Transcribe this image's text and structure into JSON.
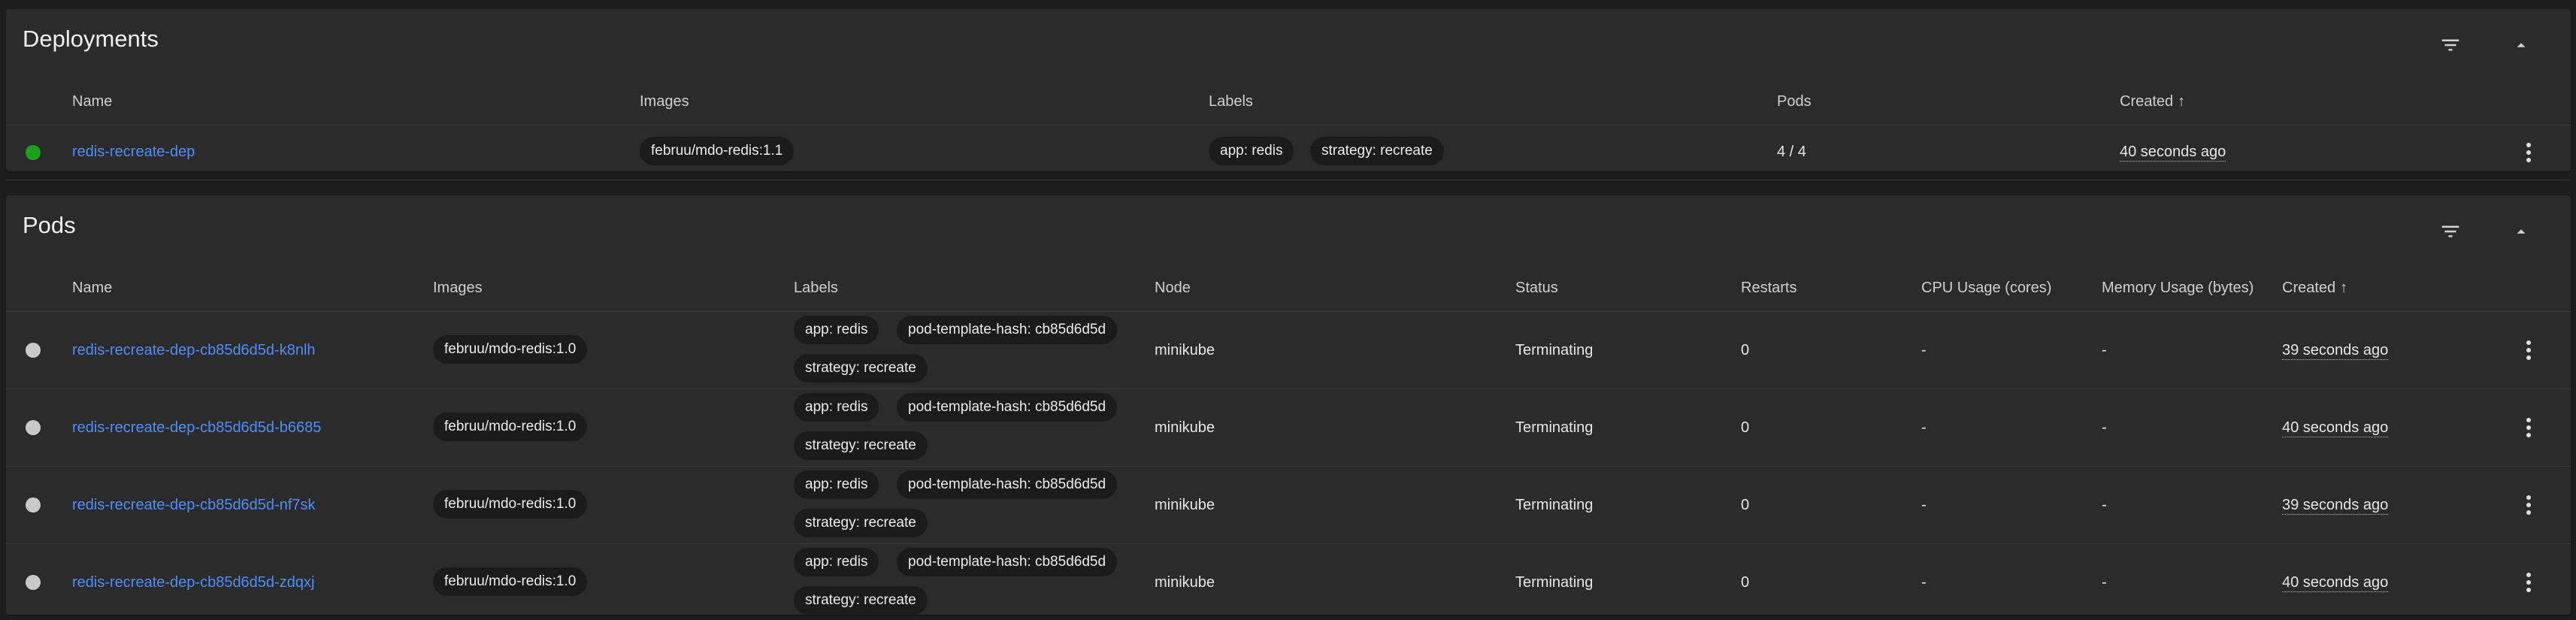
{
  "deployments": {
    "title": "Deployments",
    "columns": {
      "name": "Name",
      "images": "Images",
      "labels": "Labels",
      "pods": "Pods",
      "created": "Created"
    },
    "sort_arrow": "↑",
    "rows": [
      {
        "name": "redis-recreate-dep",
        "image": "februu/mdo-redis:1.1",
        "labels": [
          "app: redis",
          "strategy: recreate"
        ],
        "pods": "4 / 4",
        "created": "40 seconds ago",
        "status_color": "#1aa31a"
      }
    ]
  },
  "pods": {
    "title": "Pods",
    "columns": {
      "name": "Name",
      "images": "Images",
      "labels": "Labels",
      "node": "Node",
      "status": "Status",
      "restarts": "Restarts",
      "cpu": "CPU Usage (cores)",
      "memory": "Memory Usage (bytes)",
      "created": "Created"
    },
    "sort_arrow": "↑",
    "rows": [
      {
        "name": "redis-recreate-dep-cb85d6d5d-k8nlh",
        "image": "februu/mdo-redis:1.0",
        "labels": [
          "app: redis",
          "pod-template-hash: cb85d6d5d",
          "strategy: recreate"
        ],
        "node": "minikube",
        "status": "Terminating",
        "restarts": "0",
        "cpu": "-",
        "memory": "-",
        "created": "39 seconds ago"
      },
      {
        "name": "redis-recreate-dep-cb85d6d5d-b6685",
        "image": "februu/mdo-redis:1.0",
        "labels": [
          "app: redis",
          "pod-template-hash: cb85d6d5d",
          "strategy: recreate"
        ],
        "node": "minikube",
        "status": "Terminating",
        "restarts": "0",
        "cpu": "-",
        "memory": "-",
        "created": "40 seconds ago"
      },
      {
        "name": "redis-recreate-dep-cb85d6d5d-nf7sk",
        "image": "februu/mdo-redis:1.0",
        "labels": [
          "app: redis",
          "pod-template-hash: cb85d6d5d",
          "strategy: recreate"
        ],
        "node": "minikube",
        "status": "Terminating",
        "restarts": "0",
        "cpu": "-",
        "memory": "-",
        "created": "39 seconds ago"
      },
      {
        "name": "redis-recreate-dep-cb85d6d5d-zdqxj",
        "image": "februu/mdo-redis:1.0",
        "labels": [
          "app: redis",
          "pod-template-hash: cb85d6d5d",
          "strategy: recreate"
        ],
        "node": "minikube",
        "status": "Terminating",
        "restarts": "0",
        "cpu": "-",
        "memory": "-",
        "created": "40 seconds ago"
      }
    ]
  },
  "icons": {
    "filter": "filter-icon",
    "collapse": "chevron-up-icon",
    "row_menu": "more-vert-icon"
  },
  "colors": {
    "link": "#4f8ef7",
    "card": "#2b2b2b",
    "background": "#1d1d1d",
    "status_terminating": "#c9c9c9",
    "status_running": "#1aa31a"
  }
}
